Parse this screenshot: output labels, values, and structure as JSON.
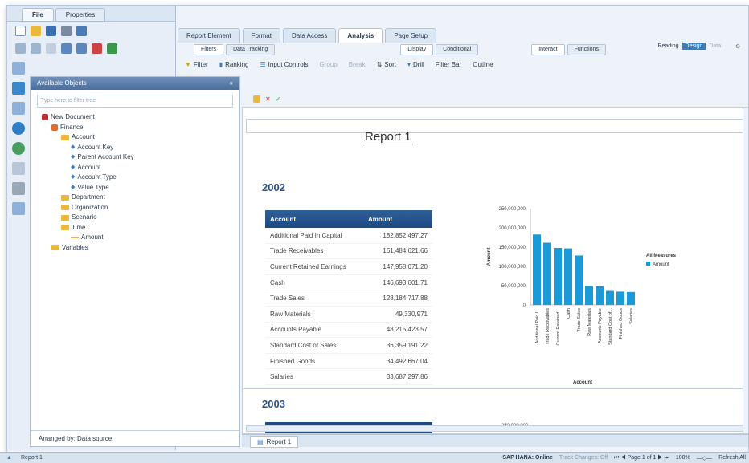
{
  "left_panel": {
    "tabs": [
      "File",
      "Properties"
    ],
    "objects_header": "Available Objects",
    "filter_placeholder": "Type here to filter tree",
    "tree": [
      {
        "label": "New Document",
        "level": 0,
        "icon": "document"
      },
      {
        "label": "Finance",
        "level": 1,
        "icon": "universe"
      },
      {
        "label": "Account",
        "level": 2,
        "icon": "folder"
      },
      {
        "label": "Account Key",
        "level": 3,
        "icon": "dimension"
      },
      {
        "label": "Parent Account Key",
        "level": 3,
        "icon": "dimension"
      },
      {
        "label": "Account",
        "level": 3,
        "icon": "dimension"
      },
      {
        "label": "Account Type",
        "level": 3,
        "icon": "dimension"
      },
      {
        "label": "Value Type",
        "level": 3,
        "icon": "dimension"
      },
      {
        "label": "Department",
        "level": 2,
        "icon": "folder"
      },
      {
        "label": "Organization",
        "level": 2,
        "icon": "folder"
      },
      {
        "label": "Scenario",
        "level": 2,
        "icon": "folder"
      },
      {
        "label": "Time",
        "level": 2,
        "icon": "folder"
      },
      {
        "label": "Amount",
        "level": 3,
        "icon": "measure"
      },
      {
        "label": "Variables",
        "level": 1,
        "icon": "folder"
      }
    ],
    "arranged_by": "Arranged by: Data source"
  },
  "ribbon": {
    "top_tabs": [
      "Report Element",
      "Format",
      "Data Access",
      "Analysis",
      "Page Setup"
    ],
    "sub_tabs": [
      "Filters",
      "Data Tracking"
    ],
    "sub_tabs2": [
      "Display",
      "Conditional"
    ],
    "sub_tabs3": [
      "Interact",
      "Functions"
    ],
    "tools": [
      "Filter",
      "Ranking",
      "Input Controls",
      "Group",
      "Break",
      "Sort",
      "Drill",
      "Filter Bar",
      "Outline"
    ],
    "modes": [
      "Reading",
      "Design",
      "Data"
    ]
  },
  "report": {
    "title": "Report 1",
    "year1": "2002",
    "year2": "2003",
    "table_headers": [
      "Account",
      "Amount"
    ],
    "rows": [
      [
        "Additional Paid In Capital",
        "182,852,497.27"
      ],
      [
        "Trade Receivables",
        "161,484,621.66"
      ],
      [
        "Current Retained Earnings",
        "147,958,071.20"
      ],
      [
        "Cash",
        "146,693,601.71"
      ],
      [
        "Trade Sales",
        "128,184,717.88"
      ],
      [
        "Raw Materials",
        "49,330,971"
      ],
      [
        "Accounts Payable",
        "48,215,423.57"
      ],
      [
        "Standard Cost of Sales",
        "36,359,191.22"
      ],
      [
        "Finished Goods",
        "34,492,667.04"
      ],
      [
        "Salaries",
        "33,687,297.86"
      ]
    ],
    "tab_label": "Report 1"
  },
  "chart_data": {
    "type": "bar",
    "categories": [
      "Additional Paid I...",
      "Trade Receivables",
      "Current Retained...",
      "Cash",
      "Trade Sales",
      "Raw Materials",
      "Accounts Payable",
      "Standard Cost of...",
      "Finished Goods",
      "Salaries"
    ],
    "series": [
      {
        "name": "Amount",
        "values": [
          182852497.27,
          161484621.66,
          147958071.2,
          146693601.71,
          128184717.88,
          49330971,
          48215423.57,
          36359191.22,
          34492667.04,
          33687297.86
        ]
      }
    ],
    "xlabel": "Account",
    "ylabel": "Amount",
    "ylim": [
      0,
      250000000
    ],
    "yticks": [
      "250,000,000",
      "200,000,000",
      "150,000,000",
      "100,000,000",
      "50,000,000",
      "0"
    ],
    "legend_title": "All Measures",
    "legend_placement": "right",
    "color": "#1a9ad6",
    "chart2_top_tick": "250,000,000"
  },
  "status": {
    "left": "Report 1",
    "connection": "SAP HANA: Online",
    "track": "Track Changes: Off",
    "page": "Page 1 of 1",
    "zoom": "100%",
    "refresh": "Refresh All"
  }
}
